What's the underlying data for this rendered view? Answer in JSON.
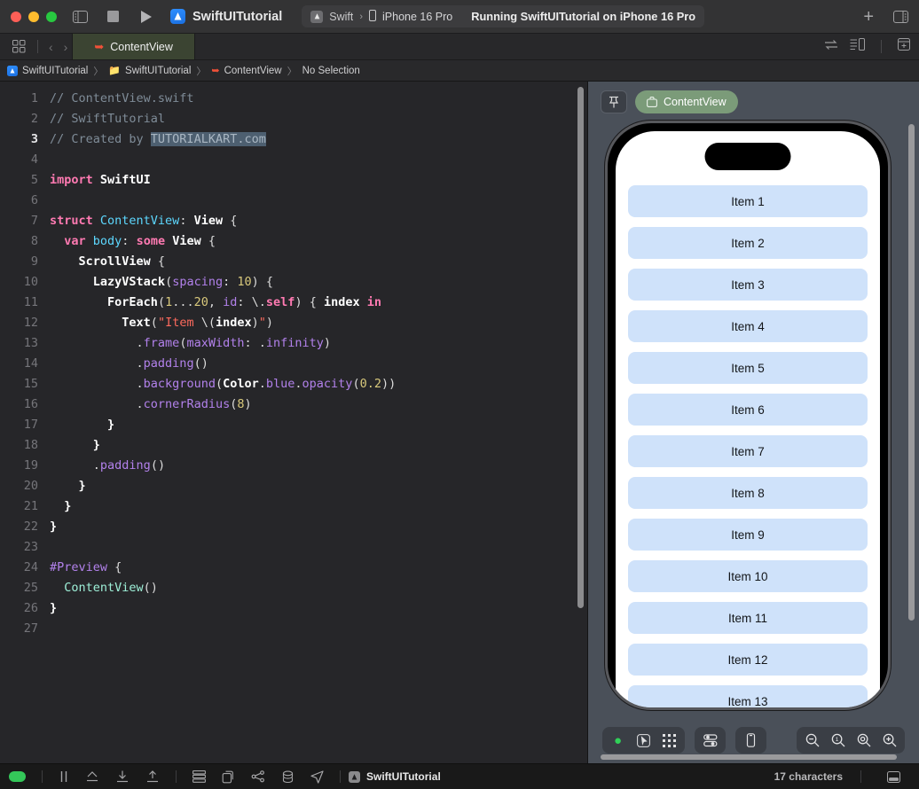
{
  "titlebar": {
    "window_controls": [
      "close",
      "minimize",
      "zoom"
    ],
    "sidebar_toggle_icon": "sidebar-toggle-icon",
    "stop_icon": "stop-icon",
    "run_icon": "run-play-icon",
    "app_icon": "xcode-app-icon",
    "scheme_name": "SwiftUITutorial",
    "run_destination": {
      "target_icon": "xcode-scheme-icon",
      "target_name": "Swift",
      "chevron": "›",
      "device_icon": "iphone-icon",
      "device_name": "iPhone 16 Pro",
      "status": "Running SwiftUITutorial on iPhone 16 Pro"
    },
    "add_label": "+",
    "inspector_toggle_icon": "inspector-toggle-icon"
  },
  "tabbar": {
    "grid_icon": "tab-overview-icon",
    "back_label": "‹",
    "forward_label": "›",
    "tabs": [
      {
        "label": "ContentView",
        "icon": "swift-file-icon",
        "active": true
      }
    ],
    "right_icons": [
      "code-review-icon",
      "split-editor-icon",
      "add-editor-icon"
    ]
  },
  "breadcrumb": {
    "items": [
      {
        "label": "SwiftUITutorial",
        "icon": "project-icon"
      },
      {
        "label": "SwiftUITutorial",
        "icon": "folder-icon"
      },
      {
        "label": "ContentView",
        "icon": "swift-file-icon"
      },
      {
        "label": "No Selection",
        "icon": "none"
      }
    ],
    "separator": "〉"
  },
  "editor": {
    "active_line": 3,
    "lines": [
      {
        "n": 1,
        "tokens": [
          {
            "t": "// ContentView.swift",
            "c": "k-comment"
          }
        ]
      },
      {
        "n": 2,
        "tokens": [
          {
            "t": "// SwiftTutorial",
            "c": "k-comment"
          }
        ]
      },
      {
        "n": 3,
        "tokens": [
          {
            "t": "// Created by ",
            "c": "k-comment"
          },
          {
            "t": "TUTORIALKART.com",
            "c": "sel"
          }
        ]
      },
      {
        "n": 4,
        "tokens": []
      },
      {
        "n": 5,
        "tokens": [
          {
            "t": "import ",
            "c": "k-keyword"
          },
          {
            "t": "SwiftUI",
            "c": "k-white"
          }
        ]
      },
      {
        "n": 6,
        "tokens": []
      },
      {
        "n": 7,
        "tokens": [
          {
            "t": "struct ",
            "c": "k-keyword"
          },
          {
            "t": "ContentView",
            "c": "k-sysType"
          },
          {
            "t": ": ",
            "c": "k-plain"
          },
          {
            "t": "View",
            "c": "k-white"
          },
          {
            "t": " {",
            "c": "k-plain"
          }
        ]
      },
      {
        "n": 8,
        "tokens": [
          {
            "t": "  ",
            "c": "k-plain"
          },
          {
            "t": "var ",
            "c": "k-keyword"
          },
          {
            "t": "body",
            "c": "k-sysType"
          },
          {
            "t": ": ",
            "c": "k-plain"
          },
          {
            "t": "some ",
            "c": "k-keyword"
          },
          {
            "t": "View",
            "c": "k-white"
          },
          {
            "t": " {",
            "c": "k-plain"
          }
        ]
      },
      {
        "n": 9,
        "tokens": [
          {
            "t": "    ",
            "c": "k-plain"
          },
          {
            "t": "ScrollView",
            "c": "k-white"
          },
          {
            "t": " {",
            "c": "k-plain"
          }
        ]
      },
      {
        "n": 10,
        "tokens": [
          {
            "t": "      ",
            "c": "k-plain"
          },
          {
            "t": "LazyVStack",
            "c": "k-white"
          },
          {
            "t": "(",
            "c": "k-plain"
          },
          {
            "t": "spacing",
            "c": "k-method"
          },
          {
            "t": ": ",
            "c": "k-plain"
          },
          {
            "t": "10",
            "c": "k-num"
          },
          {
            "t": ") {",
            "c": "k-plain"
          }
        ]
      },
      {
        "n": 11,
        "tokens": [
          {
            "t": "        ",
            "c": "k-plain"
          },
          {
            "t": "ForEach",
            "c": "k-white"
          },
          {
            "t": "(",
            "c": "k-plain"
          },
          {
            "t": "1",
            "c": "k-num"
          },
          {
            "t": "...",
            "c": "k-plain"
          },
          {
            "t": "20",
            "c": "k-num"
          },
          {
            "t": ", ",
            "c": "k-plain"
          },
          {
            "t": "id",
            "c": "k-method"
          },
          {
            "t": ": \\.",
            "c": "k-plain"
          },
          {
            "t": "self",
            "c": "k-keyword"
          },
          {
            "t": ") { ",
            "c": "k-plain"
          },
          {
            "t": "index",
            "c": "k-white"
          },
          {
            "t": " ",
            "c": "k-plain"
          },
          {
            "t": "in",
            "c": "k-keyword"
          }
        ]
      },
      {
        "n": 12,
        "tokens": [
          {
            "t": "          ",
            "c": "k-plain"
          },
          {
            "t": "Text",
            "c": "k-white"
          },
          {
            "t": "(",
            "c": "k-plain"
          },
          {
            "t": "\"Item ",
            "c": "k-string"
          },
          {
            "t": "\\(",
            "c": "k-plain"
          },
          {
            "t": "index",
            "c": "k-white"
          },
          {
            "t": ")",
            "c": "k-plain"
          },
          {
            "t": "\"",
            "c": "k-string"
          },
          {
            "t": ")",
            "c": "k-plain"
          }
        ]
      },
      {
        "n": 13,
        "tokens": [
          {
            "t": "            .",
            "c": "k-plain"
          },
          {
            "t": "frame",
            "c": "k-method"
          },
          {
            "t": "(",
            "c": "k-plain"
          },
          {
            "t": "maxWidth",
            "c": "k-method"
          },
          {
            "t": ": .",
            "c": "k-plain"
          },
          {
            "t": "infinity",
            "c": "k-method"
          },
          {
            "t": ")",
            "c": "k-plain"
          }
        ]
      },
      {
        "n": 14,
        "tokens": [
          {
            "t": "            .",
            "c": "k-plain"
          },
          {
            "t": "padding",
            "c": "k-method"
          },
          {
            "t": "()",
            "c": "k-plain"
          }
        ]
      },
      {
        "n": 15,
        "tokens": [
          {
            "t": "            .",
            "c": "k-plain"
          },
          {
            "t": "background",
            "c": "k-method"
          },
          {
            "t": "(",
            "c": "k-plain"
          },
          {
            "t": "Color",
            "c": "k-white"
          },
          {
            "t": ".",
            "c": "k-plain"
          },
          {
            "t": "blue",
            "c": "k-method"
          },
          {
            "t": ".",
            "c": "k-plain"
          },
          {
            "t": "opacity",
            "c": "k-method"
          },
          {
            "t": "(",
            "c": "k-plain"
          },
          {
            "t": "0.2",
            "c": "k-num"
          },
          {
            "t": "))",
            "c": "k-plain"
          }
        ]
      },
      {
        "n": 16,
        "tokens": [
          {
            "t": "            .",
            "c": "k-plain"
          },
          {
            "t": "cornerRadius",
            "c": "k-method"
          },
          {
            "t": "(",
            "c": "k-plain"
          },
          {
            "t": "8",
            "c": "k-num"
          },
          {
            "t": ")",
            "c": "k-plain"
          }
        ]
      },
      {
        "n": 17,
        "tokens": [
          {
            "t": "        }",
            "c": "k-white"
          }
        ]
      },
      {
        "n": 18,
        "tokens": [
          {
            "t": "      }",
            "c": "k-white"
          }
        ]
      },
      {
        "n": 19,
        "tokens": [
          {
            "t": "      .",
            "c": "k-plain"
          },
          {
            "t": "padding",
            "c": "k-method"
          },
          {
            "t": "()",
            "c": "k-plain"
          }
        ]
      },
      {
        "n": 20,
        "tokens": [
          {
            "t": "    }",
            "c": "k-white"
          }
        ]
      },
      {
        "n": 21,
        "tokens": [
          {
            "t": "  }",
            "c": "k-white"
          }
        ]
      },
      {
        "n": 22,
        "tokens": [
          {
            "t": "}",
            "c": "k-white"
          }
        ]
      },
      {
        "n": 23,
        "tokens": []
      },
      {
        "n": 24,
        "tokens": [
          {
            "t": "#Preview",
            "c": "k-method"
          },
          {
            "t": " {",
            "c": "k-plain"
          }
        ]
      },
      {
        "n": 25,
        "tokens": [
          {
            "t": "  ",
            "c": "k-plain"
          },
          {
            "t": "ContentView",
            "c": "k-class"
          },
          {
            "t": "()",
            "c": "k-plain"
          }
        ]
      },
      {
        "n": 26,
        "tokens": [
          {
            "t": "}",
            "c": "k-white"
          }
        ]
      },
      {
        "n": 27,
        "tokens": []
      }
    ]
  },
  "canvas": {
    "pin_icon": "pin-icon",
    "preview_pill": {
      "label": "ContentView",
      "icon": "preview-bag-icon"
    },
    "device": "iPhone 16 Pro",
    "items": [
      "Item 1",
      "Item 2",
      "Item 3",
      "Item 4",
      "Item 5",
      "Item 6",
      "Item 7",
      "Item 8",
      "Item 9",
      "Item 10",
      "Item 11",
      "Item 12",
      "Item 13"
    ],
    "item_background": "#cfe2fa",
    "toolbar": {
      "left_group": [
        "live-preview-play-icon",
        "select-pointer-icon",
        "variants-grid-icon"
      ],
      "device_settings_icon": "device-settings-icon",
      "device_icon": "device-bezel-icon",
      "zoom_group": [
        "zoom-out-icon",
        "zoom-100-icon",
        "zoom-fit-icon",
        "zoom-in-icon"
      ]
    }
  },
  "statusbar": {
    "left_icons": [
      "activity-pill",
      "pause-icon",
      "step-over-icon",
      "step-into-icon",
      "step-out-icon",
      "view-hierarchy-icon",
      "memory-graph-icon",
      "gauge-icon",
      "environment-icon",
      "location-icon"
    ],
    "project_icon": "xcode-app-icon",
    "project_label": "SwiftUITutorial",
    "character_count": "17 characters",
    "panel_toggle_icon": "debug-area-toggle-icon"
  }
}
